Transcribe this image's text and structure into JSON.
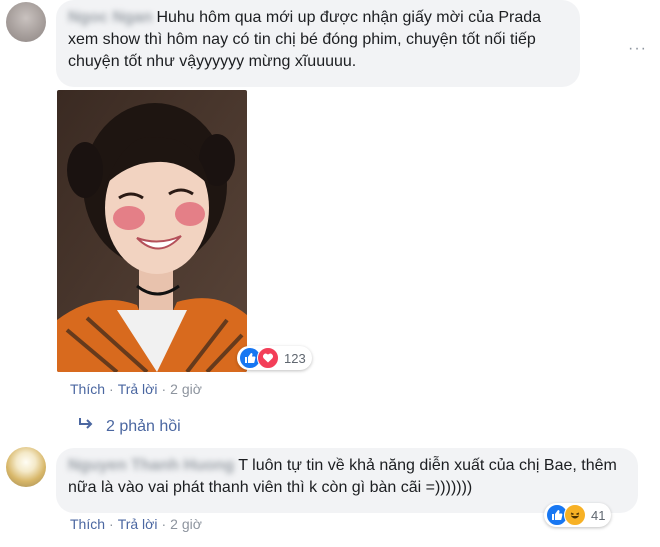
{
  "comments": [
    {
      "author_blurred": "Ngoc Ngan",
      "text": "Huhu hôm qua mới up được nhận giấy mời của Prada xem show thì hôm nay có tin chị bé đóng phim, chuyện tốt nối tiếp chuyện tốt như vậyyyyyy mừng xĩuuuuu.",
      "reactions": {
        "count": "123",
        "icons": [
          "like-icon",
          "love-icon"
        ]
      },
      "actions": {
        "like": "Thích",
        "reply": "Trả lời",
        "time": "2 giờ"
      },
      "replies_label": "2 phản hồi"
    },
    {
      "author_blurred": "Nguyen Thanh Huong",
      "text": "T luôn tự tin về khả năng diễn xuất của chị Bae, thêm nữa là vào vai phát thanh viên thì k còn gì bàn cãi =)))))))",
      "reactions": {
        "count": "41",
        "icons": [
          "like-icon",
          "haha-icon"
        ]
      },
      "actions": {
        "like": "Thích",
        "reply": "Trả lời",
        "time": "2 giờ"
      }
    }
  ],
  "menu_label": "···",
  "colors": {
    "link": "#4b67a1",
    "bubble": "#f2f3f5",
    "like": "#1877f2",
    "love": "#f33e58",
    "haha": "#f7b125"
  }
}
